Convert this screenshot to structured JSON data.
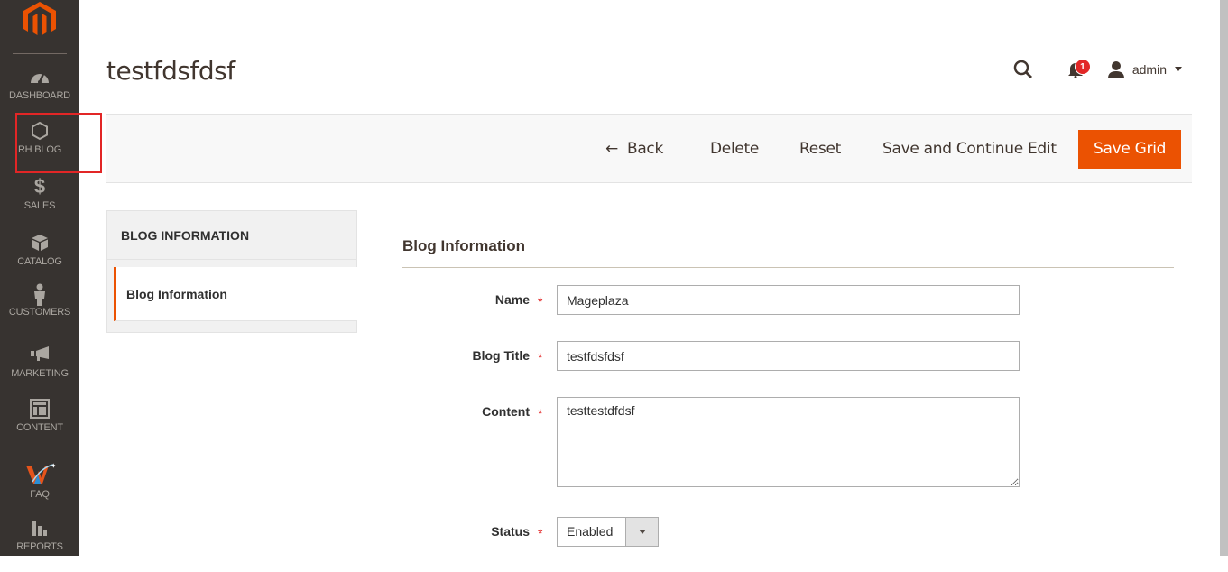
{
  "sidebar": {
    "items": [
      {
        "label": "DASHBOARD",
        "icon": "dashboard-icon"
      },
      {
        "label": "RH BLOG",
        "icon": "hexagon-icon"
      },
      {
        "label": "SALES",
        "icon": "dollar-icon"
      },
      {
        "label": "CATALOG",
        "icon": "box-icon"
      },
      {
        "label": "CUSTOMERS",
        "icon": "person-icon"
      },
      {
        "label": "MARKETING",
        "icon": "megaphone-icon"
      },
      {
        "label": "CONTENT",
        "icon": "layout-icon"
      },
      {
        "label": "FAQ",
        "icon": "faq-logo-icon"
      },
      {
        "label": "REPORTS",
        "icon": "bar-chart-icon"
      }
    ]
  },
  "header": {
    "title": "testfdsfdsf",
    "notifications_count": "1",
    "user_name": "admin"
  },
  "actions": {
    "back": "Back",
    "delete": "Delete",
    "reset": "Reset",
    "save_continue": "Save and Continue Edit",
    "save_grid": "Save Grid"
  },
  "tabs": {
    "title": "BLOG INFORMATION",
    "items": [
      {
        "label": "Blog Information",
        "active": true
      }
    ]
  },
  "form": {
    "section_title": "Blog Information",
    "fields": {
      "name": {
        "label": "Name",
        "value": "Mageplaza"
      },
      "blog_title": {
        "label": "Blog Title",
        "value": "testfdsfdsf"
      },
      "content": {
        "label": "Content",
        "value": "testtestdfdsf"
      },
      "status": {
        "label": "Status",
        "value": "Enabled"
      }
    },
    "required_mark": "*"
  },
  "colors": {
    "accent": "#eb5202",
    "sidebar_bg": "#373330",
    "badge": "#e22626"
  }
}
